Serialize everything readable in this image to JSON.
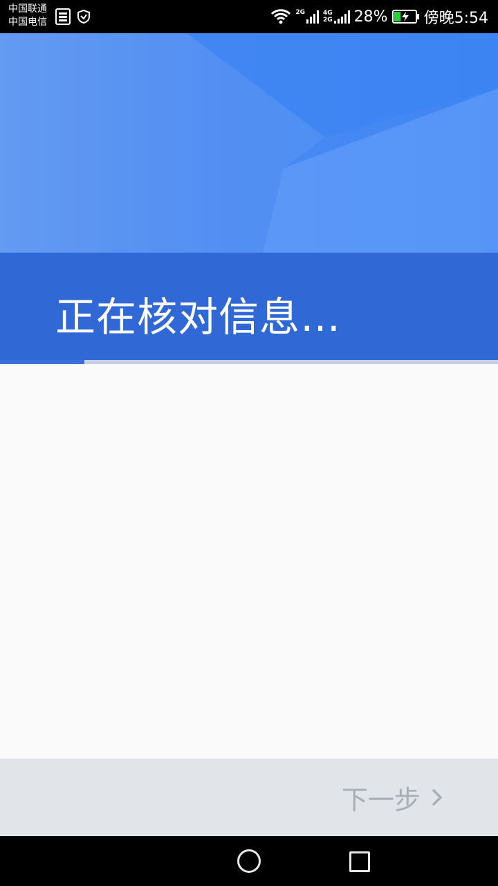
{
  "status_bar": {
    "carrier_1": "中国联通",
    "carrier_2": "中国电信",
    "network_1": "2G",
    "network_2_top": "4G",
    "network_2_bottom": "2G",
    "battery": "28%",
    "time": "傍晚5:54",
    "icons": [
      "sim-card-icon",
      "shield-icon",
      "wifi-icon",
      "signal-icon",
      "battery-charging-icon"
    ]
  },
  "header": {
    "title": "正在核对信息…",
    "colors": {
      "top": "#4a8af3",
      "band": "#3068d6"
    }
  },
  "progress": {
    "value": 0.17,
    "fill_color": "#3a6fd8"
  },
  "footer": {
    "next_label": "下一步",
    "next_icon": "chevron-right-icon",
    "disabled_color": "#a8aeb6"
  },
  "nav_bar": {
    "icons": [
      "home-circle-icon",
      "recent-apps-icon"
    ]
  }
}
